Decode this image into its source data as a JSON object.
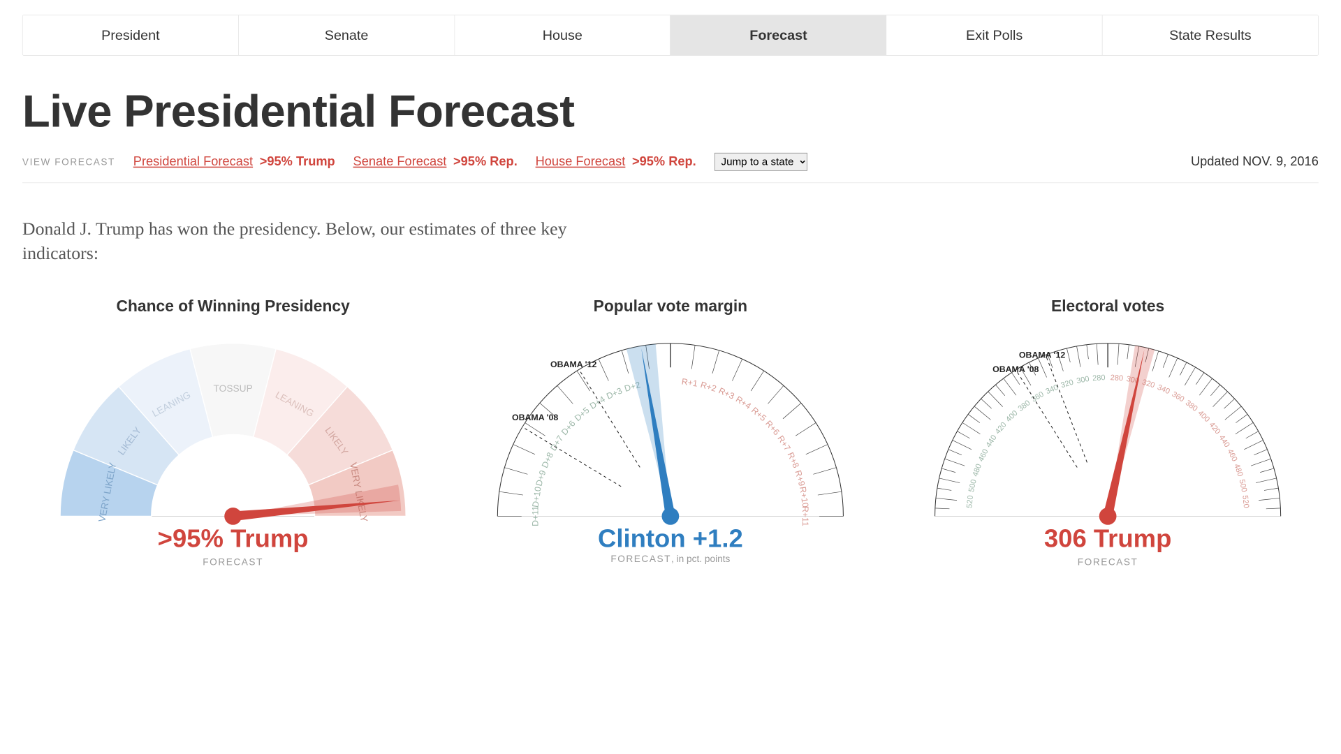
{
  "tabs": [
    "President",
    "Senate",
    "House",
    "Forecast",
    "Exit Polls",
    "State Results"
  ],
  "active_tab": "Forecast",
  "headline": "Live Presidential Forecast",
  "view_forecast_label": "VIEW FORECAST",
  "forecast_links": [
    {
      "label": "Presidential Forecast",
      "value": ">95% Trump"
    },
    {
      "label": "Senate Forecast",
      "value": ">95% Rep."
    },
    {
      "label": "House Forecast",
      "value": ">95% Rep."
    }
  ],
  "state_jump_label": "Jump to a state",
  "updated": "Updated NOV. 9, 2016",
  "intro": "Donald J. Trump has won the presidency. Below, our estimates of three key indicators:",
  "gauges": {
    "win": {
      "title": "Chance of Winning Presidency",
      "value": ">95% Trump",
      "sub": "FORECAST",
      "bands": [
        "VERY LIKELY",
        "LIKELY",
        "LEANING",
        "TOSSUP",
        "LEANING",
        "LIKELY",
        "VERY LIKELY"
      ]
    },
    "pv": {
      "title": "Popular vote margin",
      "value": "Clinton +1.2",
      "sub": "FORECAST",
      "sub2": ", in pct. points",
      "obama12": "OBAMA '12",
      "obama08": "OBAMA '08",
      "left_labels": [
        "D+2",
        "D+3",
        "D+4",
        "D+5",
        "D+6",
        "D+7",
        "D+8",
        "D+9",
        "D+10",
        "D+11"
      ],
      "right_labels": [
        "R+1",
        "R+2",
        "R+3",
        "R+4",
        "R+5",
        "R+6",
        "R+7",
        "R+8",
        "R+9",
        "R+10",
        "R+11"
      ]
    },
    "ev": {
      "title": "Electoral votes",
      "value": "306 Trump",
      "sub": "FORECAST",
      "obama12": "OBAMA '12",
      "obama08": "OBAMA '08",
      "left_labels": [
        "280",
        "300",
        "320",
        "340",
        "360",
        "380",
        "400",
        "420",
        "440",
        "460",
        "480",
        "500",
        "520"
      ],
      "right_labels": [
        "280",
        "300",
        "320",
        "340",
        "360",
        "380",
        "400",
        "420",
        "440",
        "460",
        "480",
        "500",
        "520"
      ]
    }
  },
  "chart_data": [
    {
      "type": "gauge",
      "title": "Chance of Winning Presidency",
      "range": [
        0,
        100
      ],
      "needle_value": 97,
      "winner": "Trump",
      "label": ">95% Trump",
      "bands": [
        {
          "name": "Clinton Very Likely",
          "from": 0,
          "to": 12.5,
          "color": "#b7d3ee"
        },
        {
          "name": "Clinton Likely",
          "from": 12.5,
          "to": 27,
          "color": "#d6e5f4"
        },
        {
          "name": "Clinton Leaning",
          "from": 27,
          "to": 42,
          "color": "#ecf2fa"
        },
        {
          "name": "Tossup",
          "from": 42,
          "to": 58,
          "color": "#f7f7f7"
        },
        {
          "name": "Trump Leaning",
          "from": 58,
          "to": 73,
          "color": "#fbedec"
        },
        {
          "name": "Trump Likely",
          "from": 73,
          "to": 87.5,
          "color": "#f6dcd9"
        },
        {
          "name": "Trump Very Likely",
          "from": 87.5,
          "to": 100,
          "color": "#f2cac4"
        }
      ]
    },
    {
      "type": "gauge",
      "title": "Popular vote margin",
      "range": [
        -11,
        11
      ],
      "unit": "pct. points (D negative, R positive)",
      "needle_value": -1.2,
      "label": "Clinton +1.2",
      "markers": [
        {
          "name": "OBAMA '12",
          "value": -3.9
        },
        {
          "name": "OBAMA '08",
          "value": -7.2
        }
      ]
    },
    {
      "type": "gauge",
      "title": "Electoral votes",
      "range": [
        -538,
        538
      ],
      "unit": "electoral votes to winner (D negative, R positive); 270 at top-center, 520 at far edges",
      "needle_value": 306,
      "label": "306 Trump",
      "markers": [
        {
          "name": "OBAMA '12",
          "value": -332
        },
        {
          "name": "OBAMA '08",
          "value": -365
        }
      ]
    }
  ]
}
